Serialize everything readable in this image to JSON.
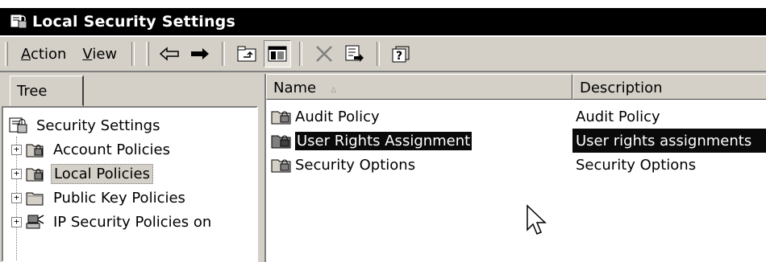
{
  "window": {
    "title": "Local Security Settings"
  },
  "menu": {
    "action": {
      "accel": "A",
      "rest": "ction"
    },
    "view": {
      "accel": "V",
      "rest": "iew"
    }
  },
  "toolbar": {
    "buttons": [
      "back-icon",
      "forward-icon",
      "up-one-level-icon",
      "show-hide-tree-icon",
      "delete-icon",
      "export-list-icon",
      "help-icon"
    ]
  },
  "tree": {
    "tab_label": "Tree",
    "root": "Security Settings",
    "items": [
      {
        "label": "Account Policies",
        "icon": "folder-lock-icon"
      },
      {
        "label": "Local Policies",
        "icon": "folder-lock-icon",
        "selected": true
      },
      {
        "label": "Public Key Policies",
        "icon": "folder-icon"
      },
      {
        "label": "IP Security Policies on",
        "icon": "ip-security-icon"
      }
    ]
  },
  "list": {
    "columns": {
      "name": "Name",
      "sort_indicator": "▵",
      "description": "Description"
    },
    "rows": [
      {
        "name": "Audit Policy",
        "description": "Audit Policy"
      },
      {
        "name": "User Rights Assignment",
        "description": "User rights assignments",
        "selected": true
      },
      {
        "name": "Security Options",
        "description": "Security Options"
      }
    ]
  },
  "colors": {
    "title_bar": "#000000",
    "face": "#d4d0c8",
    "selection": "#0a0a0a"
  }
}
